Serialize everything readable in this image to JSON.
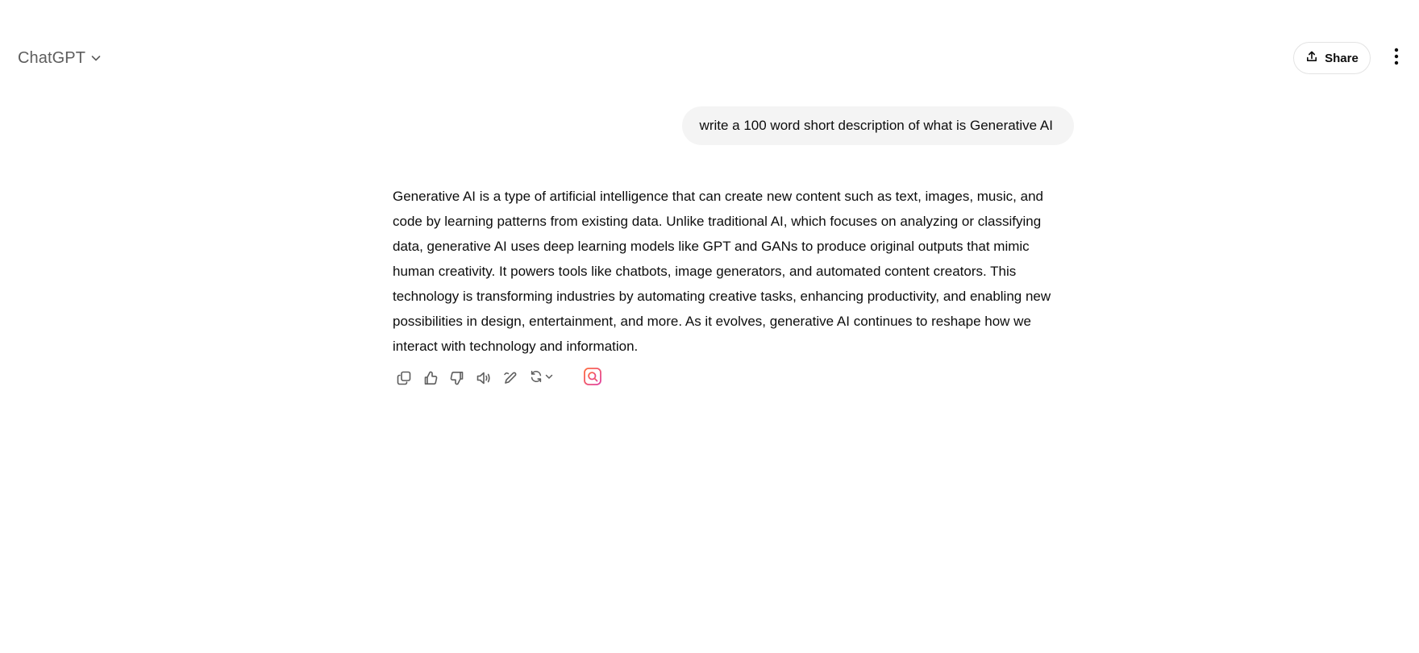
{
  "header": {
    "model_name": "ChatGPT",
    "share_label": "Share"
  },
  "conversation": {
    "user_message": "write a 100 word short description of what is Generative AI",
    "assistant_message": "Generative AI is a type of artificial intelligence that can create new content such as text, images, music, and code by learning patterns from existing data. Unlike traditional AI, which focuses on analyzing or classifying data, generative AI uses deep learning models like GPT and GANs to produce original outputs that mimic human creativity. It powers tools like chatbots, image generators, and automated content creators. This technology is transforming industries by automating creative tasks, enhancing productivity, and enabling new possibilities in design, entertainment, and more. As it evolves, generative AI continues to reshape how we interact with technology and information."
  },
  "actions": [
    {
      "icon": "copy-icon"
    },
    {
      "icon": "thumbs-up-icon"
    },
    {
      "icon": "thumbs-down-icon"
    },
    {
      "icon": "read-aloud-icon"
    },
    {
      "icon": "edit-in-canvas-icon"
    },
    {
      "icon": "regenerate-icon"
    },
    {
      "icon": "search-icon"
    }
  ],
  "colors": {
    "text": "#0d0d0d",
    "muted_text": "#5d5d5d",
    "bubble_bg": "#f4f4f4",
    "border": "#e3e3e3",
    "icon": "#5d5d5d",
    "search_gradient_start": "#ff6a3d",
    "search_gradient_end": "#e040a0"
  }
}
